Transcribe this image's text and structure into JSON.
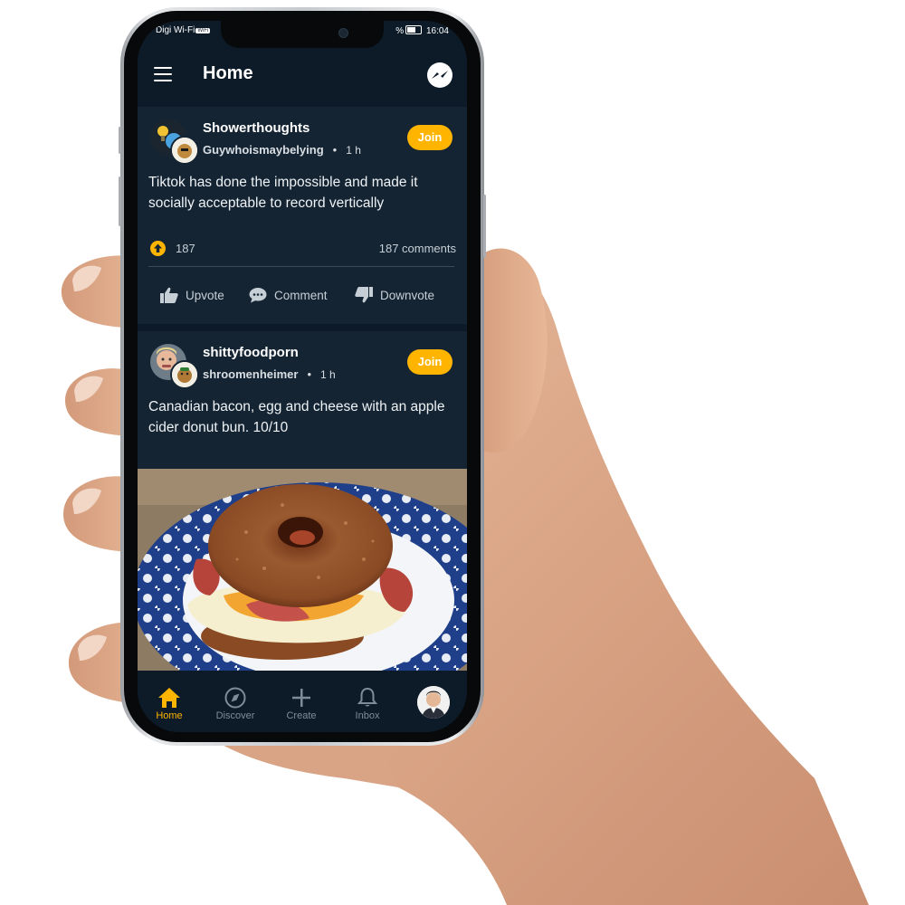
{
  "status_bar": {
    "carrier": "Digi Wi-Fi",
    "wifi_badge": "WiFi",
    "battery_label": "%",
    "time": "16:04"
  },
  "app_bar": {
    "title": "Home",
    "menu_icon": "hamburger-menu-icon",
    "chat_icon": "messenger-icon"
  },
  "posts": [
    {
      "subreddit": "Showerthoughts",
      "username": "Guywhoismaybelying",
      "separator": "•",
      "age": "1 h",
      "join_label": "Join",
      "text": "Tiktok has done the impossible and made it socially acceptable to record vertically",
      "votes": "187",
      "comments": "187 comments",
      "actions": {
        "upvote": "Upvote",
        "comment": "Comment",
        "downvote": "Downvote"
      }
    },
    {
      "subreddit": "shittyfoodporn",
      "username": "shroomenheimer",
      "separator": "•",
      "age": "1 h",
      "join_label": "Join",
      "text": "Canadian bacon, egg and cheese with an apple cider donut bun. 10/10",
      "image": "donut-breakfast-sandwich-photo"
    }
  ],
  "bottom_nav": [
    {
      "label": "Home",
      "icon": "home-icon",
      "active": true
    },
    {
      "label": "Discover",
      "icon": "compass-icon",
      "active": false
    },
    {
      "label": "Create",
      "icon": "plus-icon",
      "active": false
    },
    {
      "label": "Inbox",
      "icon": "bell-icon",
      "active": false
    },
    {
      "label": "",
      "icon": "profile-avatar",
      "active": false
    }
  ],
  "colors": {
    "accent": "#ffb400",
    "background": "#0d1b28",
    "card": "#142433"
  }
}
